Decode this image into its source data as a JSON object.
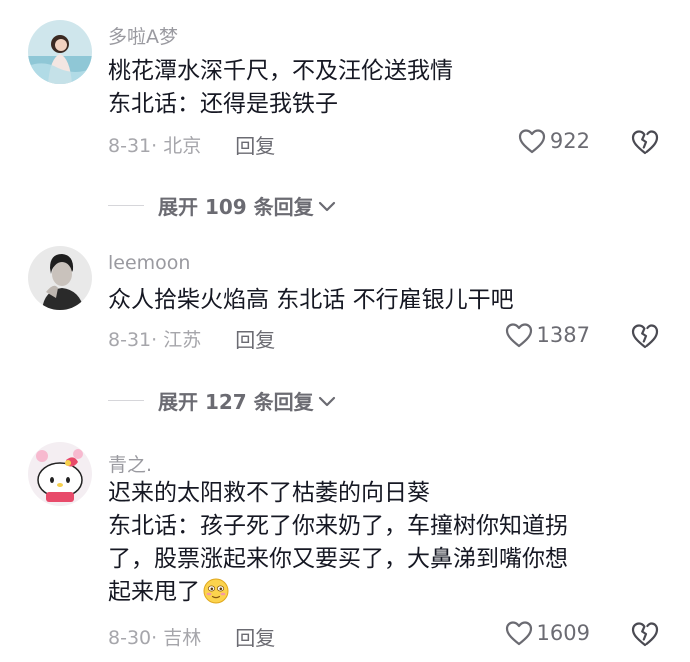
{
  "comments": [
    {
      "username": "多啦A梦",
      "lines": [
        "桃花潭水深千尺，不及汪伦送我情",
        "东北话：还得是我铁子"
      ],
      "date_location": "8-31· 北京",
      "reply_label": "回复",
      "like_count": "922",
      "expand_label": "展开 109 条回复"
    },
    {
      "username": "leemoon",
      "lines": [
        "众人拾柴火焰高  东北话  不行雇银儿干吧"
      ],
      "date_location": "8-31· 江苏",
      "reply_label": "回复",
      "like_count": "1387",
      "expand_label": "展开 127 条回复"
    },
    {
      "username": "青之.",
      "lines": [
        "迟来的太阳救不了枯萎的向日葵",
        "东北话：孩子死了你来奶了，车撞树你知道拐",
        "了，股票涨起来你又要买了，大鼻涕到嘴你想",
        "起来甩了"
      ],
      "date_location": "8-30· 吉林",
      "reply_label": "回复",
      "like_count": "1609"
    }
  ],
  "icons": {
    "like": "heart-outline-icon",
    "dislike": "broken-heart-icon",
    "expand": "chevron-down-icon",
    "emoji": "blushing-smile-emoji"
  }
}
